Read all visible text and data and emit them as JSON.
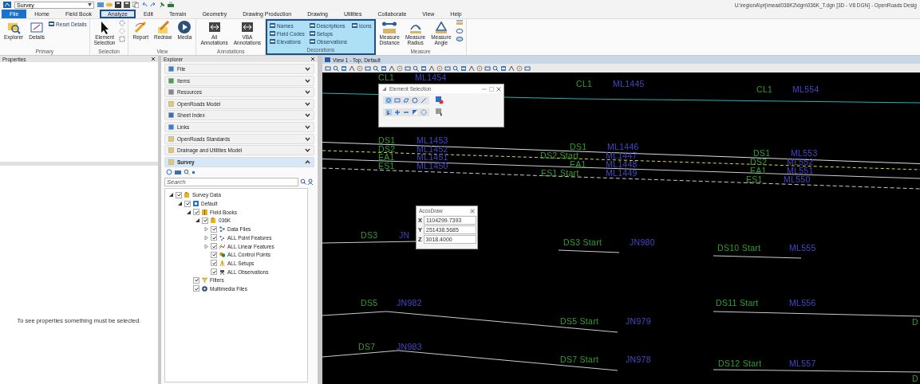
{
  "window": {
    "workspace": "Survey",
    "title": "U:\\regionA\\prj\\mead036K2\\dgn\\036K_T.dgn [3D - V8 DGN] - OpenRoads Desig"
  },
  "tabs": [
    {
      "label": "File",
      "kind": "backstage",
      "selected": false
    },
    {
      "label": "Home",
      "kind": "tab",
      "selected": false
    },
    {
      "label": "Field Book",
      "kind": "tab",
      "selected": false
    },
    {
      "label": "Analyze",
      "kind": "tab",
      "selected": true
    },
    {
      "label": "Edit",
      "kind": "tab",
      "selected": false
    },
    {
      "label": "Terrain",
      "kind": "tab",
      "selected": false
    },
    {
      "label": "Geometry",
      "kind": "tab",
      "selected": false
    },
    {
      "label": "Drawing Production",
      "kind": "tab",
      "selected": false
    },
    {
      "label": "Drawing",
      "kind": "tab",
      "selected": false
    },
    {
      "label": "Utilities",
      "kind": "tab",
      "selected": false
    },
    {
      "label": "Collaborate",
      "kind": "tab",
      "selected": false
    },
    {
      "label": "View",
      "kind": "tab",
      "selected": false
    },
    {
      "label": "Help",
      "kind": "tab",
      "selected": false
    }
  ],
  "ribbon": [
    {
      "name": "Primary",
      "highlighted": false,
      "buttons": [
        {
          "label": "Explorer",
          "kind": "large"
        },
        {
          "label": "Details",
          "kind": "large"
        },
        {
          "label": "Reset Details",
          "kind": "small"
        }
      ]
    },
    {
      "name": "Selection",
      "highlighted": false,
      "buttons": [
        {
          "label": "Element Selection",
          "kind": "large"
        }
      ]
    },
    {
      "name": "View",
      "highlighted": false,
      "buttons": [
        {
          "label": "Report",
          "kind": "large"
        },
        {
          "label": "Redraw",
          "kind": "large"
        },
        {
          "label": "Media",
          "kind": "large"
        }
      ]
    },
    {
      "name": "Annotations",
      "highlighted": false,
      "buttons": [
        {
          "label": "All Annotations",
          "kind": "large"
        },
        {
          "label": "VBA Annotations",
          "kind": "large"
        }
      ]
    },
    {
      "name": "Decorations",
      "highlighted": true,
      "buttons": [
        {
          "label": "Names",
          "kind": "small"
        },
        {
          "label": "Field Codes",
          "kind": "small"
        },
        {
          "label": "Elevations",
          "kind": "small"
        },
        {
          "label": "Descriptions",
          "kind": "small"
        },
        {
          "label": "Setups",
          "kind": "small"
        },
        {
          "label": "Observations",
          "kind": "small"
        },
        {
          "label": "Icons",
          "kind": "small"
        }
      ]
    },
    {
      "name": "Measure",
      "highlighted": false,
      "buttons": [
        {
          "label": "Measure Distance",
          "kind": "large"
        },
        {
          "label": "Measure Radius",
          "kind": "large"
        },
        {
          "label": "Measure Angle",
          "kind": "large"
        }
      ]
    }
  ],
  "properties": {
    "title": "Properties",
    "message": "To see properties something must be selected."
  },
  "explorer": {
    "title": "Explorer",
    "sections": [
      {
        "label": "File",
        "expanded": false
      },
      {
        "label": "Items",
        "expanded": false
      },
      {
        "label": "Resources",
        "expanded": false
      },
      {
        "label": "OpenRoads Model",
        "expanded": false
      },
      {
        "label": "Sheet Index",
        "expanded": false
      },
      {
        "label": "Links",
        "expanded": false
      },
      {
        "label": "OpenRoads Standards",
        "expanded": false
      },
      {
        "label": "Drainage and Utilities Model",
        "expanded": false
      },
      {
        "label": "Survey",
        "expanded": true
      }
    ],
    "search": {
      "placeholder": "Search"
    },
    "tree": [
      {
        "label": "Survey Data",
        "kind": "folder",
        "checked": true,
        "expanded": true,
        "children": [
          {
            "label": "Default",
            "kind": "model",
            "checked": true,
            "expanded": true,
            "children": [
              {
                "label": "Field Books",
                "kind": "book",
                "checked": true,
                "expanded": true,
                "children": [
                  {
                    "label": "036K",
                    "kind": "folder",
                    "checked": true,
                    "expanded": true,
                    "children": [
                      {
                        "label": "Data Files",
                        "kind": "data",
                        "checked": true,
                        "expanded": false
                      },
                      {
                        "label": "ALL Point Features",
                        "kind": "point",
                        "checked": true,
                        "expanded": false
                      },
                      {
                        "label": "ALL Linear Features",
                        "kind": "linear",
                        "checked": true,
                        "expanded": false
                      },
                      {
                        "label": "ALL Control Points",
                        "kind": "control",
                        "checked": true
                      },
                      {
                        "label": "ALL Setups",
                        "kind": "setup",
                        "checked": true
                      },
                      {
                        "label": "ALL Observations",
                        "kind": "observation",
                        "checked": true
                      }
                    ]
                  }
                ]
              },
              {
                "label": "Filters",
                "kind": "filter",
                "checked": true
              },
              {
                "label": "Multimedia Files",
                "kind": "media",
                "checked": true
              }
            ]
          }
        ]
      }
    ]
  },
  "view": {
    "title": "View 1 - Top, Default",
    "labels": [
      {
        "text": "CL1",
        "kind": "code"
      },
      {
        "text": "ML1454",
        "kind": "point"
      },
      {
        "text": "CL1",
        "kind": "code"
      },
      {
        "text": "ML1445",
        "kind": "point"
      },
      {
        "text": "CL1",
        "kind": "code"
      },
      {
        "text": "ML554",
        "kind": "point"
      },
      {
        "text": "DS1",
        "kind": "code"
      },
      {
        "text": "ML1453",
        "kind": "point"
      },
      {
        "text": "DS2",
        "kind": "code"
      },
      {
        "text": "ML1452",
        "kind": "point"
      },
      {
        "text": "EA1",
        "kind": "code"
      },
      {
        "text": "ML1451",
        "kind": "point"
      },
      {
        "text": "ES1",
        "kind": "code"
      },
      {
        "text": "ML1450",
        "kind": "point"
      },
      {
        "text": "DS1",
        "kind": "code"
      },
      {
        "text": "ML1446",
        "kind": "point"
      },
      {
        "text": "DS2 Start",
        "kind": "code"
      },
      {
        "text": "ML1447",
        "kind": "point"
      },
      {
        "text": "EA1",
        "kind": "code"
      },
      {
        "text": "ML1448",
        "kind": "point"
      },
      {
        "text": "ES1 Start",
        "kind": "code"
      },
      {
        "text": "ML1449",
        "kind": "point"
      },
      {
        "text": "DS1",
        "kind": "code"
      },
      {
        "text": "ML553",
        "kind": "point"
      },
      {
        "text": "DS2",
        "kind": "code"
      },
      {
        "text": "ML552",
        "kind": "point"
      },
      {
        "text": "EA1",
        "kind": "code"
      },
      {
        "text": "ML551",
        "kind": "point"
      },
      {
        "text": "ES1",
        "kind": "code"
      },
      {
        "text": "ML550",
        "kind": "point"
      },
      {
        "text": "DS3",
        "kind": "code"
      },
      {
        "text": "JN",
        "kind": "point"
      },
      {
        "text": "DS3 Start",
        "kind": "code"
      },
      {
        "text": "JN980",
        "kind": "point"
      },
      {
        "text": "DS10 Start",
        "kind": "code"
      },
      {
        "text": "ML555",
        "kind": "point"
      },
      {
        "text": "DS5",
        "kind": "code"
      },
      {
        "text": "JN982",
        "kind": "point"
      },
      {
        "text": "DS5 Start",
        "kind": "code"
      },
      {
        "text": "JN979",
        "kind": "point"
      },
      {
        "text": "DS11 Start",
        "kind": "code"
      },
      {
        "text": "ML556",
        "kind": "point"
      },
      {
        "text": "DS7",
        "kind": "code"
      },
      {
        "text": "JN983",
        "kind": "point"
      },
      {
        "text": "DS7 Start",
        "kind": "code"
      },
      {
        "text": "JN978",
        "kind": "point"
      },
      {
        "text": "DS12 Start",
        "kind": "code"
      },
      {
        "text": "ML557",
        "kind": "point"
      },
      {
        "text": "D",
        "kind": "code"
      },
      {
        "text": "D",
        "kind": "code"
      }
    ],
    "element_selection": {
      "title": "Element Selection"
    },
    "accudraw": {
      "title": "AccuDraw",
      "fields": [
        {
          "axis": "X",
          "value": "1104299.7393"
        },
        {
          "axis": "Y",
          "value": "251438.5685"
        },
        {
          "axis": "Z",
          "value": "3018.4000"
        }
      ]
    }
  }
}
